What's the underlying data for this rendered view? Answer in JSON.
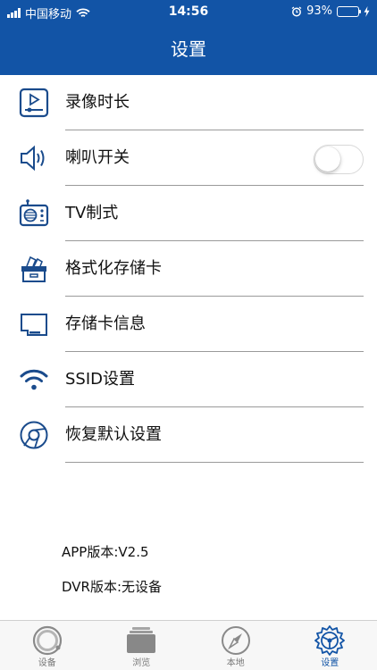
{
  "status_bar": {
    "carrier": "中国移动",
    "time": "14:56",
    "battery": "93%",
    "battery_level": 0.93,
    "icons": [
      "signal-icon",
      "wifi-icon",
      "alarm-icon",
      "battery-icon",
      "charging-icon"
    ]
  },
  "nav": {
    "title": "设置"
  },
  "menu": {
    "items": [
      {
        "label": "录像时长",
        "icon": "video-duration-icon"
      },
      {
        "label": "喇叭开关",
        "icon": "speaker-icon",
        "toggle_on": false
      },
      {
        "label": "TV制式",
        "icon": "tv-icon"
      },
      {
        "label": "格式化存储卡",
        "icon": "format-box-icon"
      },
      {
        "label": "存储卡信息",
        "icon": "sd-card-icon"
      },
      {
        "label": "SSID设置",
        "icon": "wifi-icon"
      },
      {
        "label": "恢复默认设置",
        "icon": "reset-icon"
      }
    ]
  },
  "versions": {
    "app": "APP版本:V2.5",
    "dvr": "DVR版本:无设备"
  },
  "tabs": [
    {
      "label": "设备",
      "icon": "device-icon",
      "active": false
    },
    {
      "label": "浏览",
      "icon": "browse-icon",
      "active": false
    },
    {
      "label": "本地",
      "icon": "compass-icon",
      "active": false
    },
    {
      "label": "设置",
      "icon": "settings-icon",
      "active": true
    }
  ],
  "colors": {
    "accent": "#1254a6",
    "battery_fill": "#4cd964"
  }
}
